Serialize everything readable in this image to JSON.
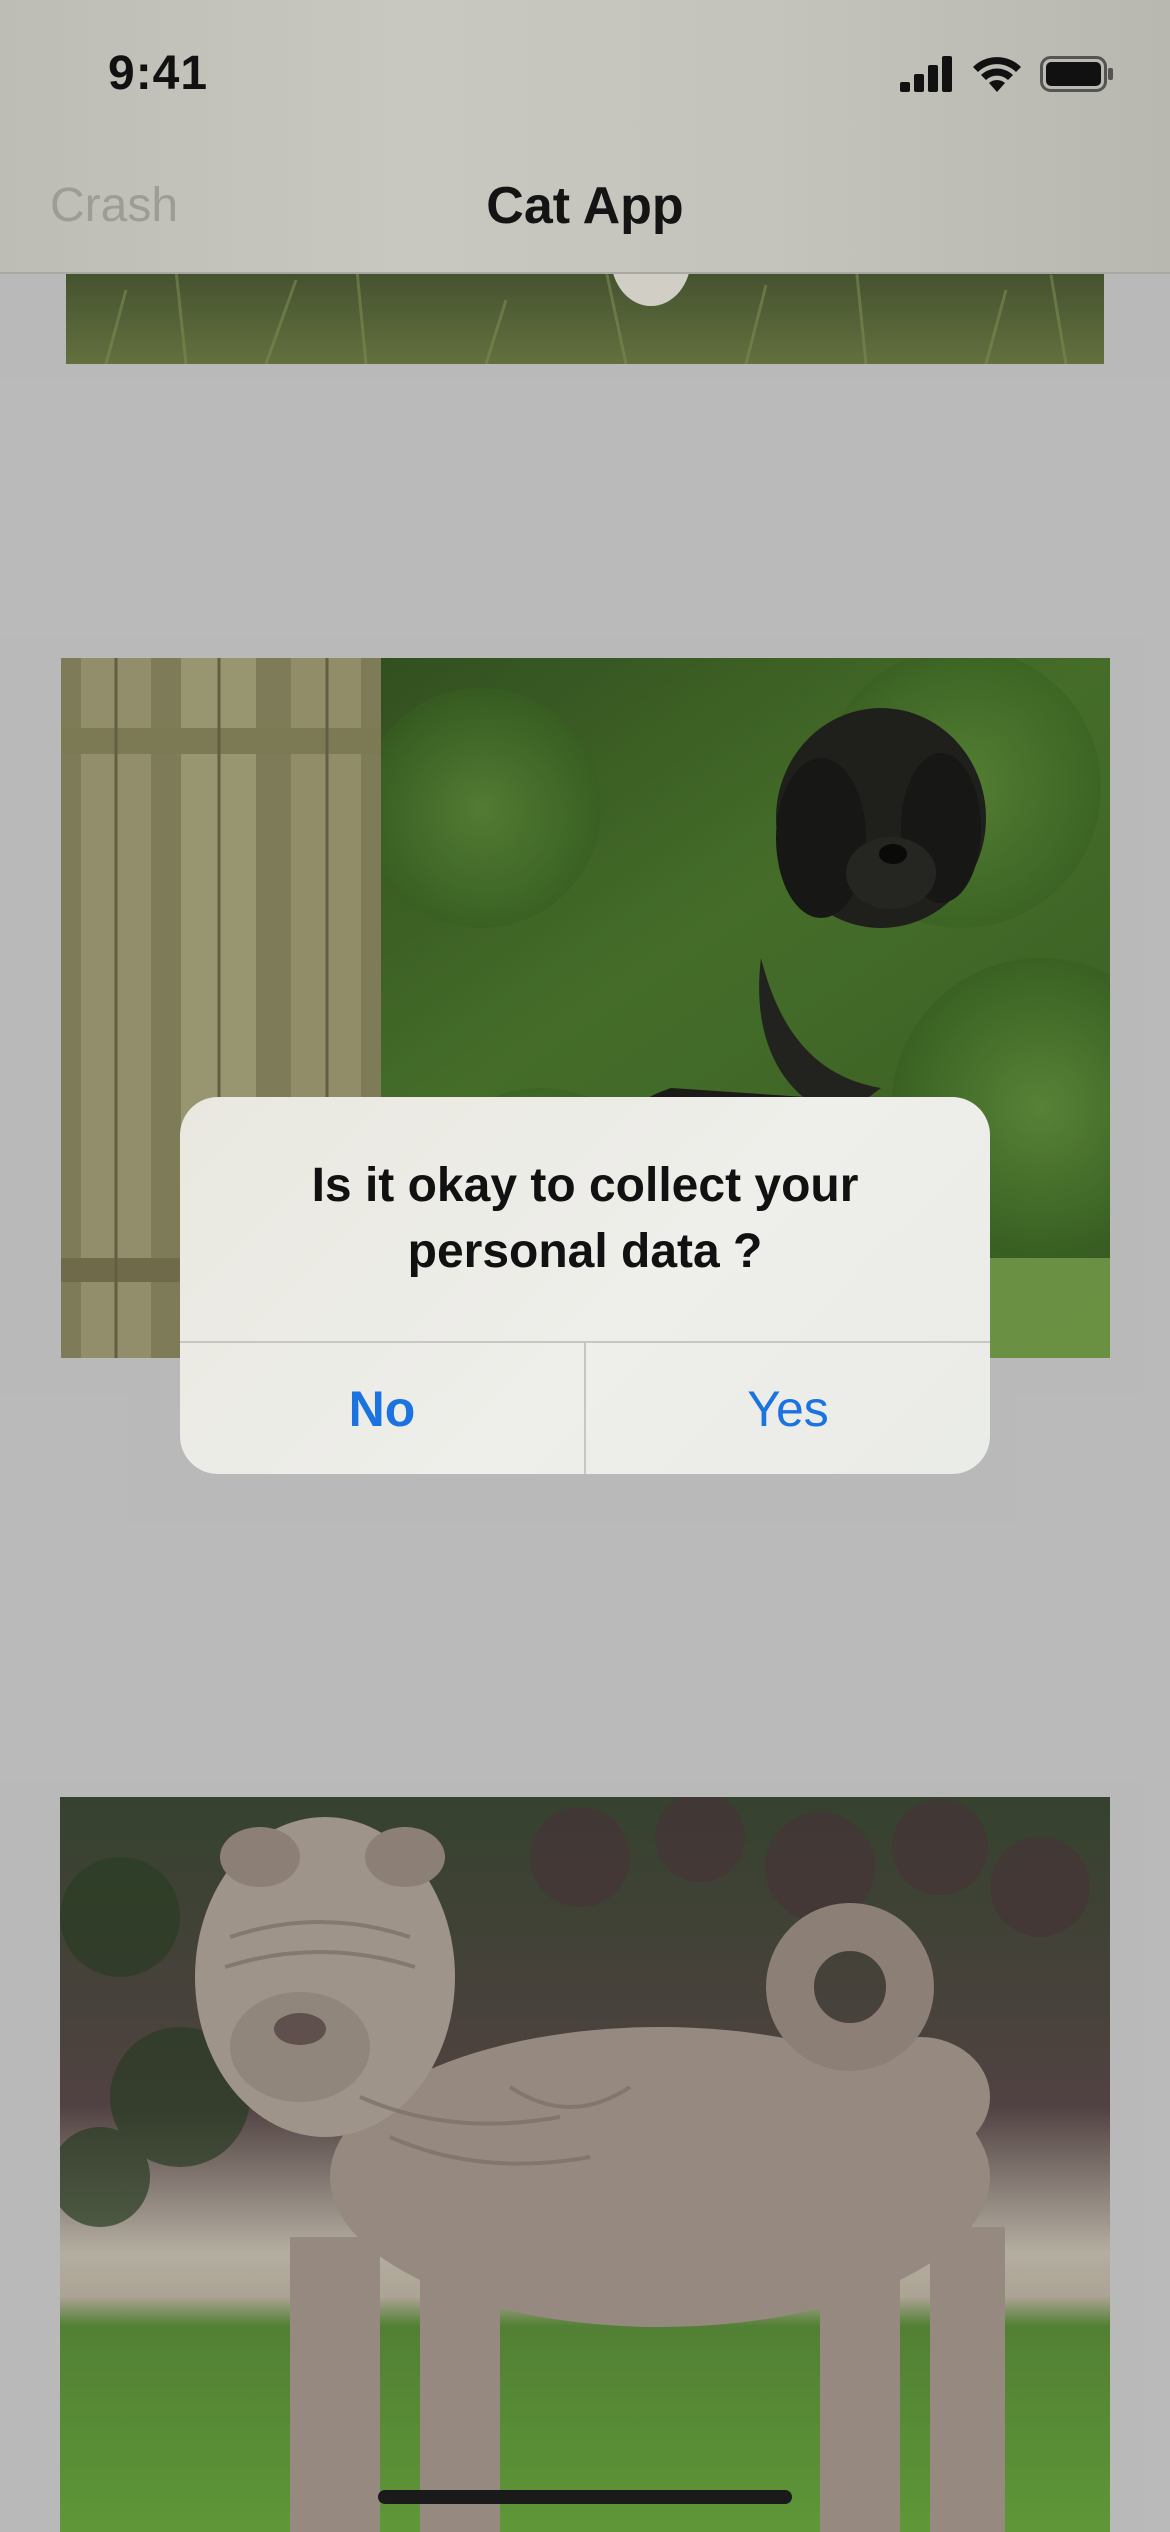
{
  "status_bar": {
    "time": "9:41",
    "icons": [
      "cellular-signal-icon",
      "wifi-icon",
      "battery-icon"
    ]
  },
  "nav_bar": {
    "left_button": "Crash",
    "title": "Cat App"
  },
  "feed": {
    "items": [
      {
        "image": "dog-photo-on-grass-cropped"
      },
      {
        "image": "black-curly-dog-by-wooden-fence"
      },
      {
        "image": "shar-pei-dog-on-grass"
      }
    ]
  },
  "alert": {
    "message": "Is it okay to collect your personal data ?",
    "no_label": "No",
    "yes_label": "Yes"
  },
  "colors": {
    "accent": "#1a73e0",
    "background": "#cfcfcf"
  }
}
